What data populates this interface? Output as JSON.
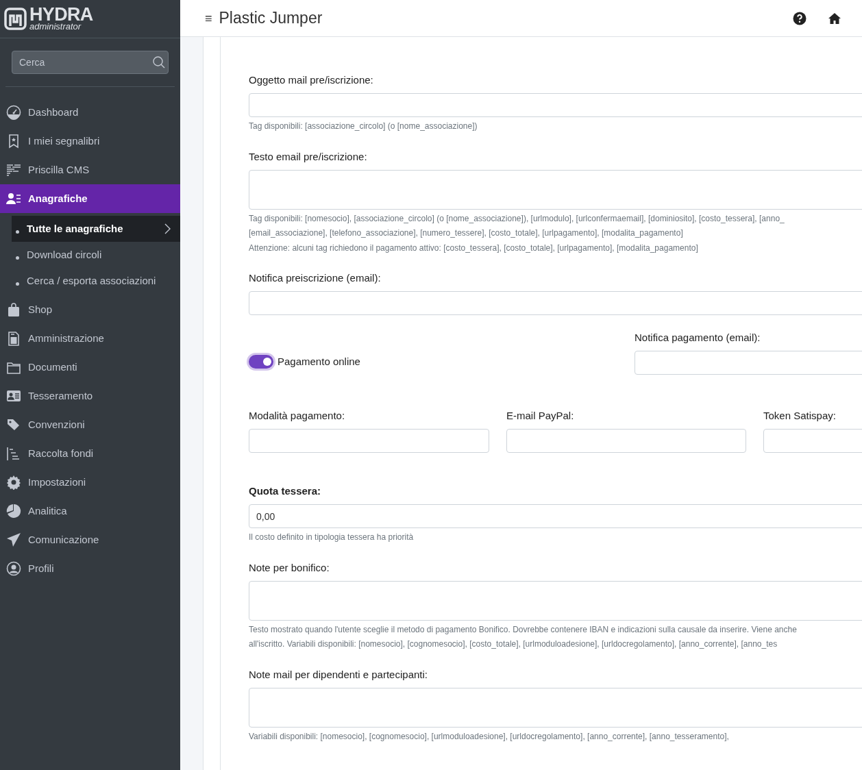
{
  "sidebar": {
    "logo": {
      "title": "HYDRA",
      "subtitle": "administrator"
    },
    "search": {
      "placeholder": "Cerca"
    },
    "items": [
      {
        "label": "Dashboard",
        "selected": false
      },
      {
        "label": "I miei segnalibri",
        "selected": false
      },
      {
        "label": "Priscilla CMS",
        "selected": false
      },
      {
        "label": "Anagrafiche",
        "selected": true,
        "children": [
          {
            "label": "Tutte le anagrafiche",
            "selected": true
          },
          {
            "label": "Download circoli",
            "selected": false
          },
          {
            "label": "Cerca / esporta associazioni",
            "selected": false
          }
        ]
      },
      {
        "label": "Shop",
        "selected": false
      },
      {
        "label": "Amministrazione",
        "selected": false
      },
      {
        "label": "Documenti",
        "selected": false
      },
      {
        "label": "Tesseramento",
        "selected": false
      },
      {
        "label": "Convenzioni",
        "selected": false
      },
      {
        "label": "Raccolta fondi",
        "selected": false
      },
      {
        "label": "Impostazioni",
        "selected": false
      },
      {
        "label": "Analitica",
        "selected": false
      },
      {
        "label": "Comunicazione",
        "selected": false
      },
      {
        "label": "Profili",
        "selected": false
      }
    ]
  },
  "header": {
    "menu_icon": "≡",
    "title": "Plastic Jumper"
  },
  "form": [
    {
      "kind": "input",
      "label": "Oggetto mail pre/iscrizione:",
      "bold": false,
      "help": [
        "Tag disponibili: [associazione_circolo] (o [nome_associazione])"
      ]
    },
    {
      "kind": "textarea",
      "label": "Testo email pre/iscrizione:",
      "bold": false,
      "help": [
        "Tag disponibili: [nomesocio], [associazione_circolo] (o [nome_associazione]), [urlmodulo], [urlconfermaemail], [dominiosito], [costo_tessera], [anno_",
        "[email_associazione], [telefono_associazione], [numero_tessere], [costo_totale], [urlpagamento], [modalita_pagamento]",
        "Attenzione: alcuni tag richiedono il pagamento attivo: [costo_tessera], [costo_totale], [urlpagamento], [modalita_pagamento]"
      ]
    },
    {
      "kind": "input",
      "label": "Notifica preiscrizione (email):",
      "bold": false
    },
    {
      "kind": "toggle_row",
      "toggle": {
        "label": "Pagamento online",
        "on": true
      },
      "field": {
        "label": "Notifica pagamento (email):"
      }
    },
    {
      "kind": "columns",
      "fields": [
        {
          "label": "Modalità pagamento:"
        },
        {
          "label": "E-mail PayPal:"
        },
        {
          "label": "Token Satispay:"
        }
      ]
    },
    {
      "kind": "input",
      "label": "Quota tessera:",
      "bold": true,
      "value": "0,00",
      "help": [
        "Il costo definito in tipologia tessera ha priorità"
      ]
    },
    {
      "kind": "textarea",
      "label": "Note per bonifico:",
      "bold": false,
      "help": [
        "Testo mostrato quando l'utente sceglie il metodo di pagamento Bonifico. Dovrebbe contenere IBAN e indicazioni sulla causale da inserire. Viene anche",
        "all'iscritto. Variabili disponibili: [nomesocio], [cognomesocio], [costo_totale], [urlmoduloadesione], [urldocregolamento], [anno_corrente], [anno_tes"
      ]
    },
    {
      "kind": "textarea",
      "label": "Note mail per dipendenti e partecipanti:",
      "bold": false,
      "help": [
        "Variabili disponibili: [nomesocio], [cognomesocio], [urlmoduloadesione], [urldocregolamento], [anno_corrente], [anno_tesseramento],"
      ]
    }
  ]
}
